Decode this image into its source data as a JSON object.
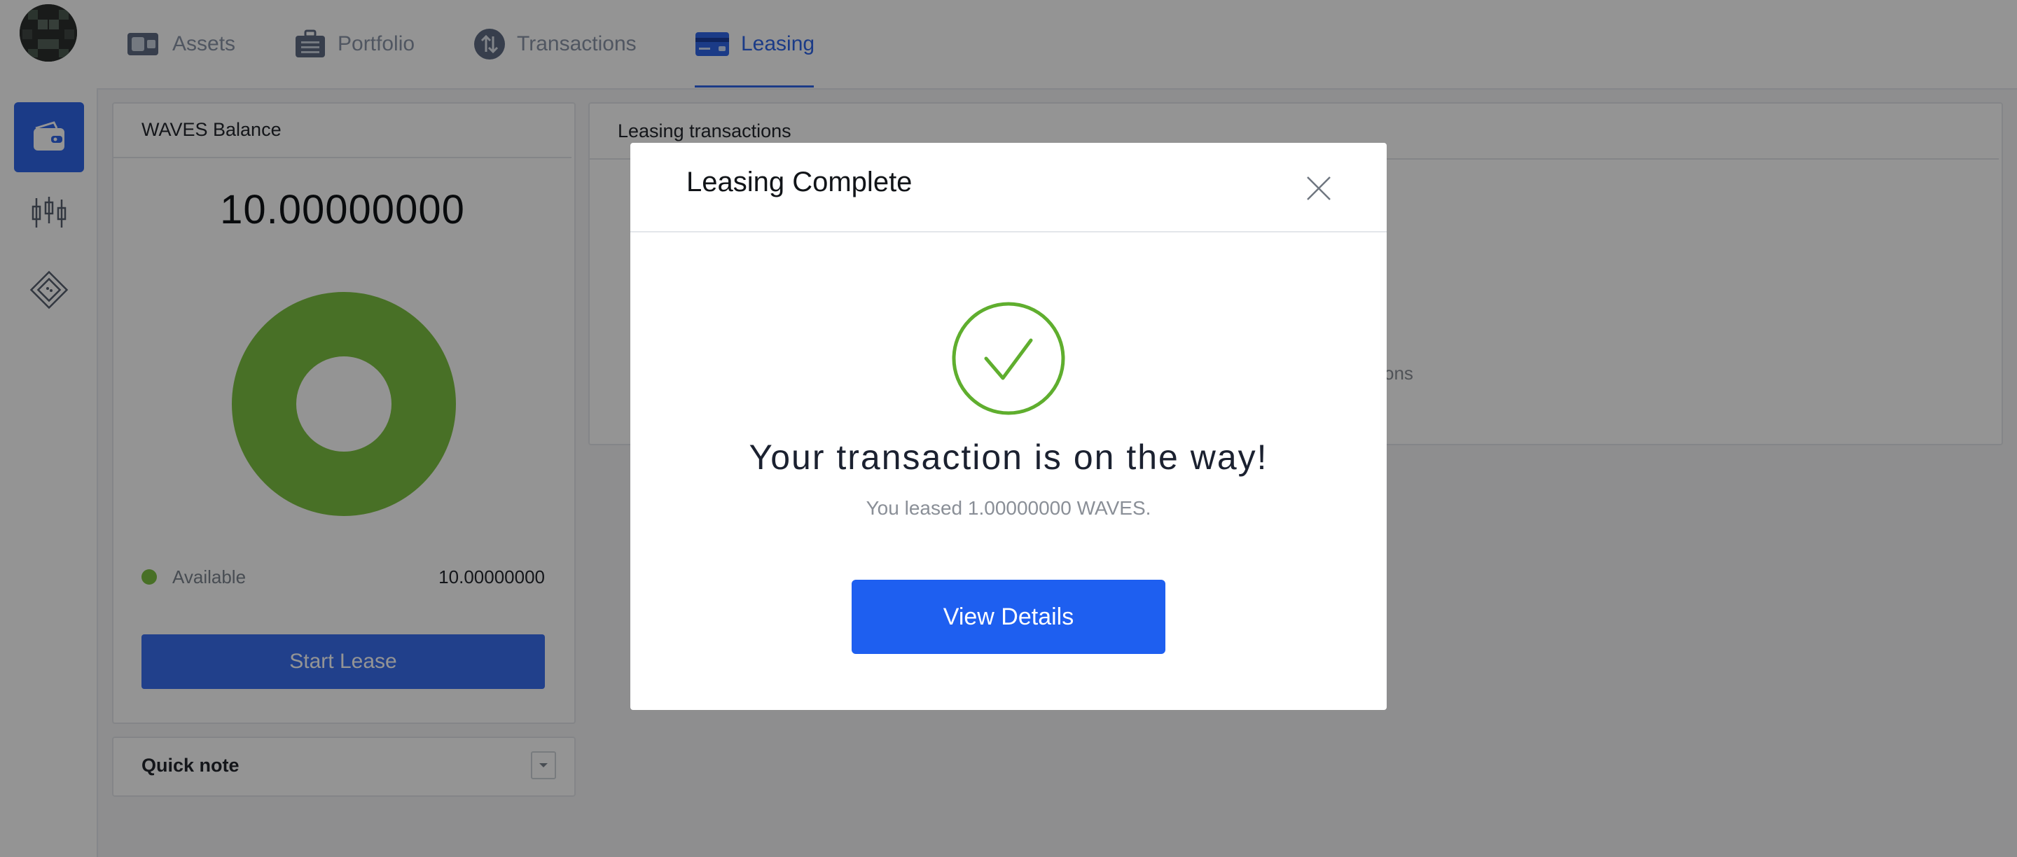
{
  "nav": {
    "tabs": [
      {
        "label": "Assets",
        "icon": "wallet-icon"
      },
      {
        "label": "Portfolio",
        "icon": "briefcase-icon"
      },
      {
        "label": "Transactions",
        "icon": "arrows-updown-icon"
      },
      {
        "label": "Leasing",
        "icon": "card-icon",
        "active": true
      }
    ]
  },
  "sidebar": {
    "items": [
      {
        "name": "wallet",
        "icon": "wallet-icon",
        "active": true
      },
      {
        "name": "dex",
        "icon": "candlestick-icon"
      },
      {
        "name": "tokens",
        "icon": "diamond-icon"
      }
    ]
  },
  "balance_panel": {
    "title": "WAVES Balance",
    "amount": "10.00000000",
    "legend": [
      {
        "label": "Available",
        "value": "10.00000000",
        "color": "#7cc142"
      }
    ],
    "start_lease_label": "Start Lease"
  },
  "quick_note": {
    "title": "Quick note"
  },
  "leasing_panel": {
    "title": "Leasing transactions",
    "empty_text_fragment": "ctions"
  },
  "modal": {
    "title": "Leasing Complete",
    "heading": "Your transaction is on the way!",
    "subtext": "You leased 1.00000000 WAVES.",
    "button_label": "View Details",
    "success_color": "#5fae2e"
  },
  "colors": {
    "accent": "#2f66e8",
    "button_primary": "#1e5ff0",
    "chart_green": "#7cc142"
  }
}
